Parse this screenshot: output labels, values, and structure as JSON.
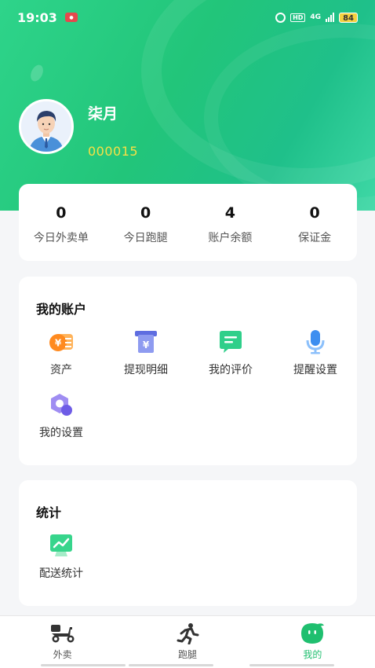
{
  "status_bar": {
    "time": "19:03",
    "network": "4G",
    "hd": "HD",
    "battery": "84"
  },
  "profile": {
    "name": "柒月",
    "id": "000015"
  },
  "stats": [
    {
      "value": "0",
      "label": "今日外卖单"
    },
    {
      "value": "0",
      "label": "今日跑腿"
    },
    {
      "value": "4",
      "label": "账户余额"
    },
    {
      "value": "0",
      "label": "保证金"
    }
  ],
  "account": {
    "title": "我的账户",
    "items": [
      {
        "label": "资产",
        "icon": "assets-icon"
      },
      {
        "label": "提现明细",
        "icon": "withdraw-detail-icon"
      },
      {
        "label": "我的评价",
        "icon": "review-icon"
      },
      {
        "label": "提醒设置",
        "icon": "microphone-icon"
      },
      {
        "label": "我的设置",
        "icon": "settings-hex-icon"
      }
    ]
  },
  "statistics": {
    "title": "统计",
    "items": [
      {
        "label": "配送统计",
        "icon": "delivery-chart-icon"
      }
    ]
  },
  "tabs": [
    {
      "label": "外卖",
      "icon": "scooter-icon",
      "active": false
    },
    {
      "label": "跑腿",
      "icon": "runner-icon",
      "active": false
    },
    {
      "label": "我的",
      "icon": "my-face-icon",
      "active": true
    }
  ],
  "colors": {
    "brand_green": "#22c57a",
    "id_yellow": "#f7e046",
    "active_tab": "#1fbf6f"
  }
}
